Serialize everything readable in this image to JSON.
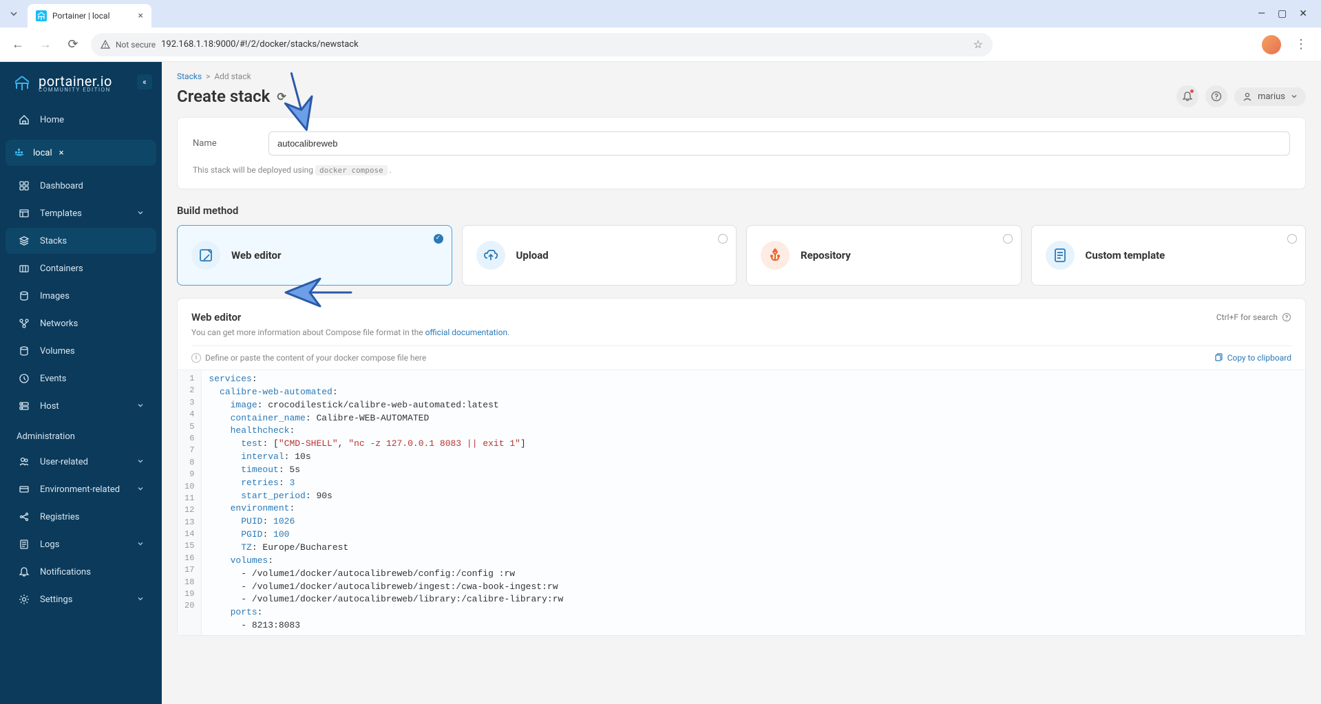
{
  "browser": {
    "tab_title": "Portainer | local",
    "not_secure": "Not secure",
    "url": "192.168.1.18:9000/#!/2/docker/stacks/newstack"
  },
  "sidebar": {
    "logo": "portainer.io",
    "logo_sub": "COMMUNITY EDITION",
    "home": "Home",
    "env_name": "local",
    "items": [
      {
        "label": "Dashboard"
      },
      {
        "label": "Templates"
      },
      {
        "label": "Stacks"
      },
      {
        "label": "Containers"
      },
      {
        "label": "Images"
      },
      {
        "label": "Networks"
      },
      {
        "label": "Volumes"
      },
      {
        "label": "Events"
      },
      {
        "label": "Host"
      }
    ],
    "admin_label": "Administration",
    "admin_items": [
      {
        "label": "User-related"
      },
      {
        "label": "Environment-related"
      },
      {
        "label": "Registries"
      },
      {
        "label": "Logs"
      },
      {
        "label": "Notifications"
      },
      {
        "label": "Settings"
      }
    ]
  },
  "breadcrumb": {
    "stacks": "Stacks",
    "add": "Add stack"
  },
  "page_title": "Create stack",
  "user_name": "marius",
  "form": {
    "name_label": "Name",
    "name_value": "autocalibreweb",
    "hint_pre": "This stack will be deployed using ",
    "hint_code": "docker compose",
    "hint_post": " ."
  },
  "build_method": {
    "heading": "Build method",
    "options": [
      {
        "title": "Web editor"
      },
      {
        "title": "Upload"
      },
      {
        "title": "Repository"
      },
      {
        "title": "Custom template"
      }
    ]
  },
  "editor": {
    "title": "Web editor",
    "search_hint": "Ctrl+F for search",
    "info_pre": "You can get more information about Compose file format in the ",
    "info_link": "official documentation",
    "info_post": ".",
    "placeholder_hint": "Define or paste the content of your docker compose file here",
    "copy_label": "Copy to clipboard",
    "code": [
      {
        "t": "key",
        "indent": 0,
        "key": "services",
        "after": ":"
      },
      {
        "t": "key",
        "indent": 2,
        "key": "calibre-web-automated",
        "after": ":"
      },
      {
        "t": "kv",
        "indent": 4,
        "key": "image",
        "val": " crocodilestick/calibre-web-automated:latest"
      },
      {
        "t": "kv",
        "indent": 4,
        "key": "container_name",
        "val": " Calibre-WEB-AUTOMATED"
      },
      {
        "t": "key",
        "indent": 4,
        "key": "healthcheck",
        "after": ":"
      },
      {
        "t": "test",
        "indent": 6,
        "key": "test",
        "s1": "\"CMD-SHELL\"",
        "s2": "\"nc -z 127.0.0.1 8083 || exit 1\""
      },
      {
        "t": "kv",
        "indent": 6,
        "key": "interval",
        "val": " 10s"
      },
      {
        "t": "kv",
        "indent": 6,
        "key": "timeout",
        "val": " 5s"
      },
      {
        "t": "kn",
        "indent": 6,
        "key": "retries",
        "num": "3"
      },
      {
        "t": "kv",
        "indent": 6,
        "key": "start_period",
        "val": " 90s"
      },
      {
        "t": "key",
        "indent": 4,
        "key": "environment",
        "after": ":"
      },
      {
        "t": "kn",
        "indent": 6,
        "key": "PUID",
        "num": "1026"
      },
      {
        "t": "kn",
        "indent": 6,
        "key": "PGID",
        "num": "100"
      },
      {
        "t": "kv",
        "indent": 6,
        "key": "TZ",
        "val": " Europe/Bucharest"
      },
      {
        "t": "key",
        "indent": 4,
        "key": "volumes",
        "after": ":"
      },
      {
        "t": "plain",
        "indent": 6,
        "text": "- /volume1/docker/autocalibreweb/config:/config :rw"
      },
      {
        "t": "plain",
        "indent": 6,
        "text": "- /volume1/docker/autocalibreweb/ingest:/cwa-book-ingest:rw"
      },
      {
        "t": "plain",
        "indent": 6,
        "text": "- /volume1/docker/autocalibreweb/library:/calibre-library:rw"
      },
      {
        "t": "key",
        "indent": 4,
        "key": "ports",
        "after": ":"
      },
      {
        "t": "plain",
        "indent": 6,
        "text": "- 8213:8083"
      }
    ]
  }
}
